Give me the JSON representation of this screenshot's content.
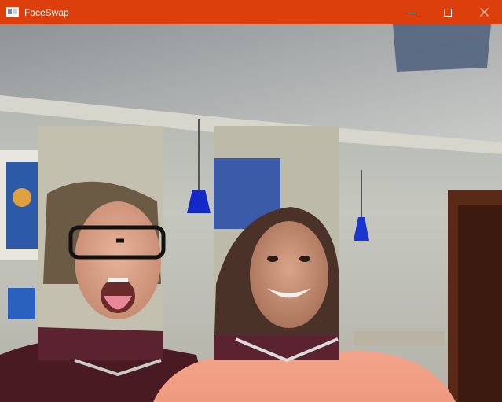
{
  "window": {
    "title": "FaceSwap",
    "accent_color": "#dc3e0c",
    "app_icon": "app-window-icon",
    "controls": [
      "minimize-icon",
      "maximize-icon",
      "close-icon"
    ]
  },
  "video": {
    "description_icon": "webcam-feed",
    "face_swap_regions": 2
  }
}
